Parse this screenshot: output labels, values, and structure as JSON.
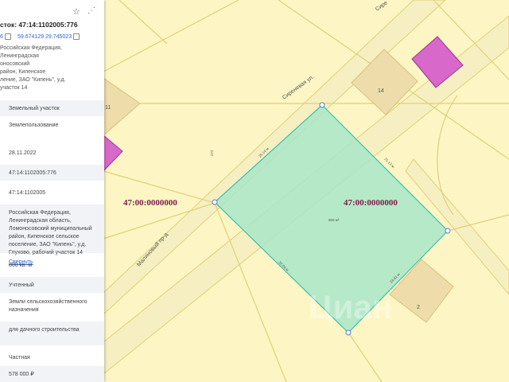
{
  "panel": {
    "title": "сток: 47:14:1102005:776",
    "coord_left": "6",
    "coord_right": "59.674129 29.745023",
    "address_lines": [
      "Российская Федерация, Ленинградская",
      "оносовский",
      "район, Кипенское",
      "ление, ЗАО \"Кипень\", у.д.",
      "участок 14"
    ],
    "rows": [
      {
        "label": "",
        "value": "Земельный участок"
      },
      {
        "label": "",
        "value": "Землепользование"
      },
      {
        "label": "",
        "value": "28.11.2022"
      },
      {
        "label": "",
        "value": "47:14:1102005:776"
      },
      {
        "label": "",
        "value": "47:14:1102005"
      },
      {
        "label": "",
        "value": "Российская Федерация, Ленинградская область, Ломоносовский муниципальный район, Кипенское сельское поселение, ЗАО \"Кипень\", у.д. Глухово, рабочий участок 14",
        "link": "Свернуть"
      },
      {
        "label": "",
        "value": "800 кв. м"
      },
      {
        "label": "",
        "value": "Учтенный"
      },
      {
        "label": "",
        "value": "Земли сельскохозяйственного назначения"
      },
      {
        "label": "",
        "value": "для дачного строительства"
      },
      {
        "label": "",
        "value": "Частная"
      },
      {
        "label": "",
        "value": "578 000 ₽"
      }
    ]
  },
  "map": {
    "block_label_left": "47:00:0000000",
    "block_label_right": "47:00:0000000",
    "street_top": "Сиреневая ул.",
    "street_top_right": "Сире",
    "street_left": "Малиновый пр-д",
    "area": "800 м²",
    "building_14": "14",
    "building_2": "2",
    "building_11": "11",
    "side_ne": "31.13 м",
    "side_nw": "25.14 м",
    "side_sw": "32.04 м",
    "side_se": "24.91 м",
    "road_num": "272",
    "watermark": "Циан",
    "colors": {
      "parcel_fill": "#a9e6c8",
      "parcel_stroke": "#3bbfae",
      "background": "#fdf6c4",
      "boundary": "#e2cf76",
      "building": "#eeddaa",
      "magenta": "#d868c9"
    }
  }
}
